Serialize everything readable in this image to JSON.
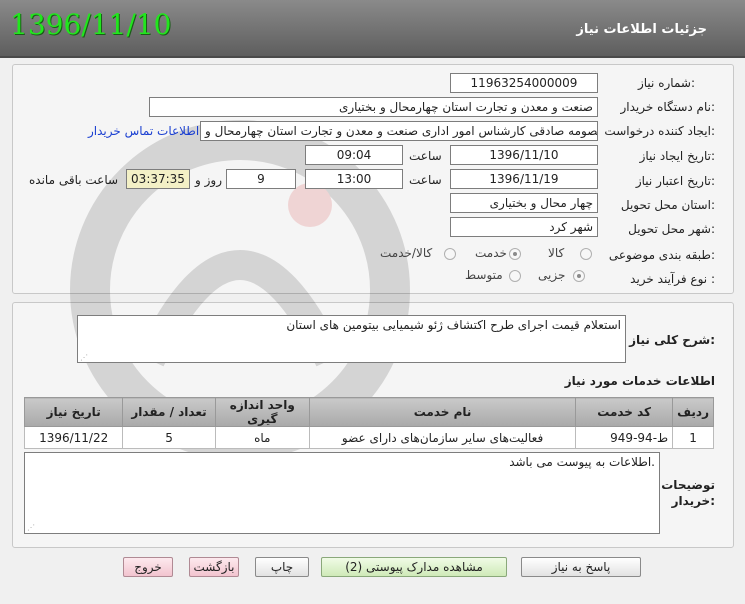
{
  "header": {
    "title": "جزئیات اطلاعات نیاز",
    "date": "1396/11/10"
  },
  "form": {
    "need_number_label": "شماره نیاز:",
    "need_number": "11963254000009",
    "buyer_org_label": "نام دستگاه خریدار:",
    "buyer_org": "صنعت و معدن و تجارت استان چهارمحال و بختیاری",
    "requester_label": "ایجاد کننده درخواست:",
    "requester": "معصومه صادقی کارشناس امور اداری صنعت و معدن و تجارت استان چهارمحال و",
    "contact_link": "اطلاعات تماس خریدار",
    "created_label": "تاریخ ایجاد نیاز:",
    "created_date": "1396/11/10",
    "time_label": "ساعت",
    "created_time": "09:04",
    "validity_label": "تاریخ اعتبار نیاز:",
    "validity_date": "1396/11/19",
    "validity_time": "13:00",
    "days": "9",
    "days_label": "روز و",
    "remaining_time": "03:37:35",
    "remaining_label": "ساعت باقی مانده",
    "province_label": "استان محل تحویل:",
    "province": "چهار محال و بختیاری",
    "city_label": "شهر محل تحویل:",
    "city": "شهر کرد",
    "category_label": "طبقه بندی موضوعی:",
    "category_options": [
      "کالا",
      "خدمت",
      "کالا/خدمت"
    ],
    "category_selected": "خدمت",
    "process_label": "نوع فرآیند خرید :",
    "process_options": [
      "جزیی",
      "متوسط"
    ],
    "process_selected": "جزیی"
  },
  "summary": {
    "label": "شرح کلی نیاز:",
    "text": "استعلام قیمت اجرای طرح اکتشاف ژئو شیمیایی بیتومین های استان"
  },
  "services": {
    "section_title": "اطلاعات خدمات مورد نیاز",
    "headers": [
      "ردیف",
      "کد خدمت",
      "نام خدمت",
      "واحد اندازه گیری",
      "تعداد / مقدار",
      "تاریخ نیاز"
    ],
    "rows": [
      {
        "index": "1",
        "code": "ط-94-949",
        "name": "فعالیت‌های سایر سازمان‌های دارای عضو",
        "unit": "ماه",
        "qty": "5",
        "date": "1396/11/22"
      }
    ]
  },
  "buyer_notes": {
    "label_line1": "توضیحات",
    "label_line2": "خریدار:",
    "text": "اطلاعات به پیوست می باشد."
  },
  "buttons": {
    "reply": "پاسخ به نیاز",
    "docs": "مشاهده مدارک پیوستی (2)",
    "print": "چاپ",
    "back": "بازگشت",
    "exit": "خروج"
  }
}
